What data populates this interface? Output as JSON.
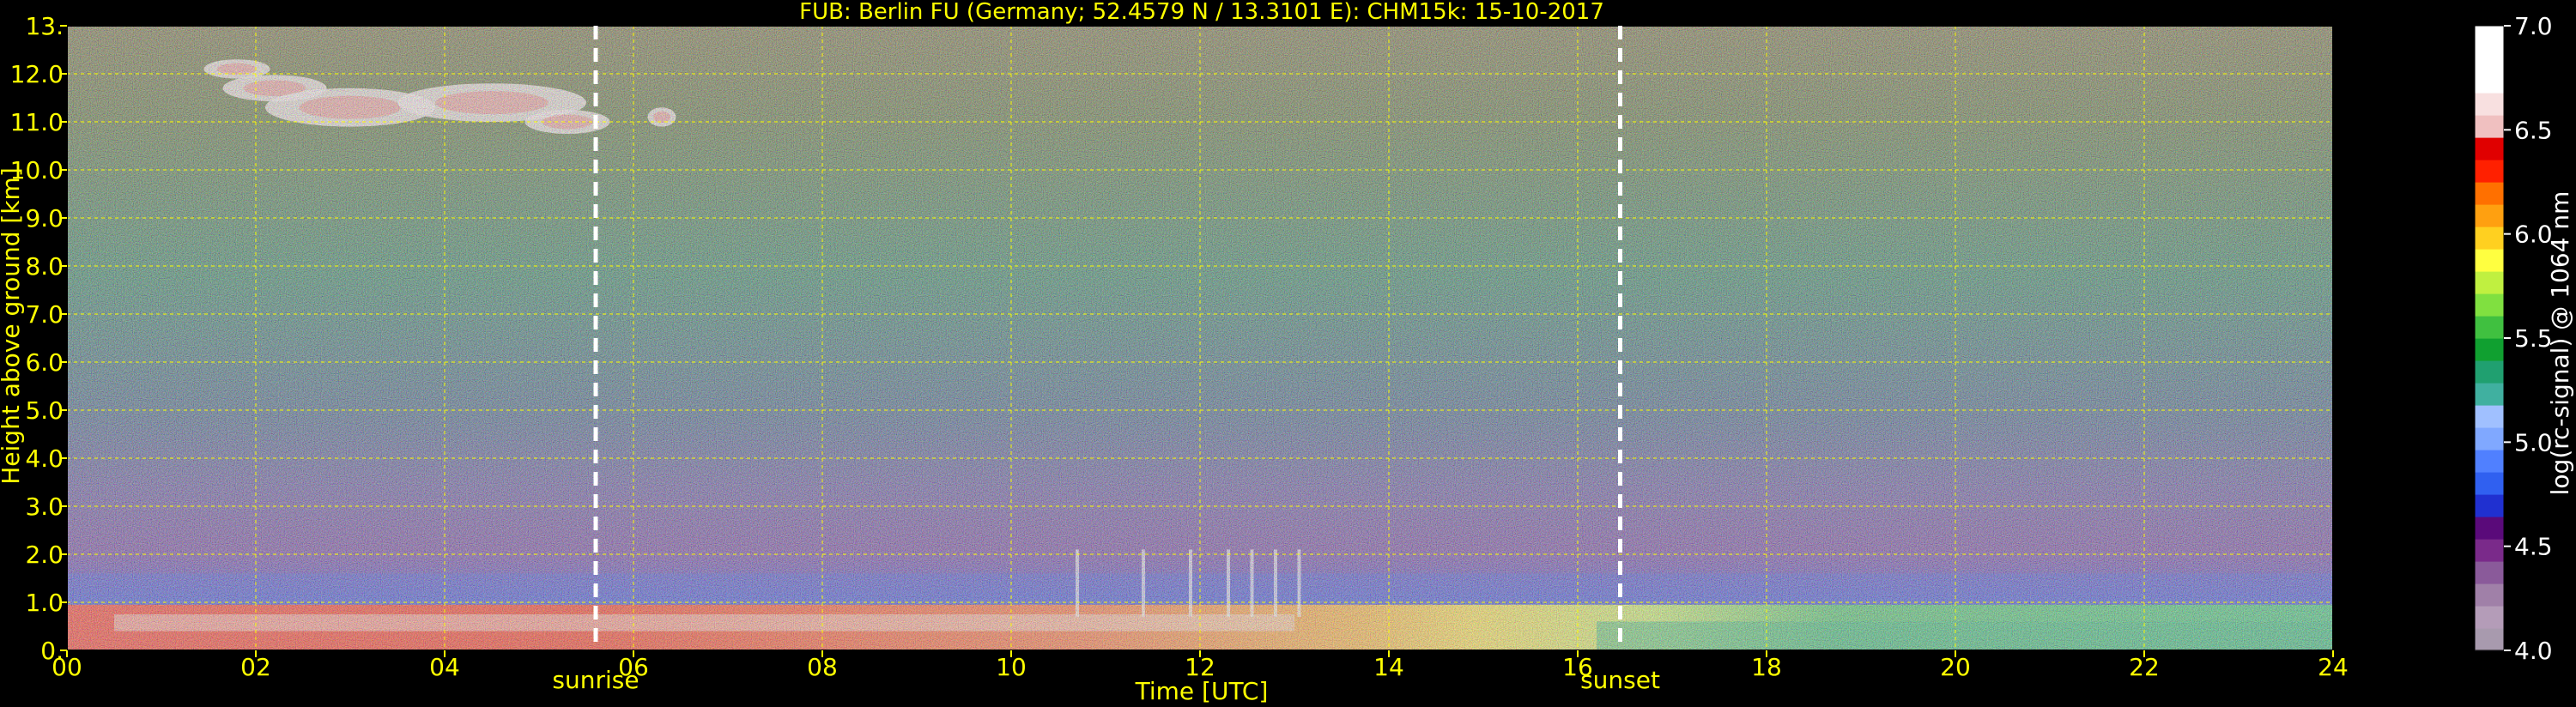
{
  "chart_data": {
    "type": "heatmap",
    "title": "FUB: Berlin FU (Germany; 52.4579 N / 13.3101 E):    CHM15k: 15-10-2017",
    "xlabel": "Time [UTC]",
    "ylabel": "Height above ground [km]",
    "xlim": [
      0,
      24
    ],
    "ylim": [
      0,
      13
    ],
    "x_ticks": [
      "00",
      "02",
      "04",
      "06",
      "08",
      "10",
      "12",
      "14",
      "16",
      "18",
      "20",
      "22",
      "24"
    ],
    "y_ticks": [
      "0.",
      "1.0",
      "2.0",
      "3.0",
      "4.0",
      "5.0",
      "6.0",
      "7.0",
      "8.0",
      "9.0",
      "10.0",
      "11.0",
      "12.0",
      "13."
    ],
    "grid": true,
    "annotations": [
      {
        "label": "sunrise",
        "x": 5.6
      },
      {
        "label": "sunset",
        "x": 16.45
      }
    ],
    "colorbar": {
      "label": "log(rc-signal) @ 1064 nm",
      "range": [
        4.0,
        7.0
      ],
      "ticks": [
        "4.0",
        "4.5",
        "5.0",
        "5.5",
        "6.0",
        "6.5",
        "7.0"
      ],
      "colors": [
        "#a89aae",
        "#b49cb8",
        "#a080a8",
        "#8a5a9a",
        "#7a2a8a",
        "#5a0a7a",
        "#2030d0",
        "#3060f0",
        "#5080ff",
        "#80a8ff",
        "#a0c0ff",
        "#40b0a0",
        "#20a070",
        "#10a030",
        "#40c040",
        "#80e040",
        "#c0f040",
        "#ffff40",
        "#ffd020",
        "#ffa010",
        "#ff7000",
        "#ff2000",
        "#e00000",
        "#f0c0c0",
        "#f8e0e0",
        "#ffffff",
        "#ffffff",
        "#ffffff"
      ]
    }
  }
}
